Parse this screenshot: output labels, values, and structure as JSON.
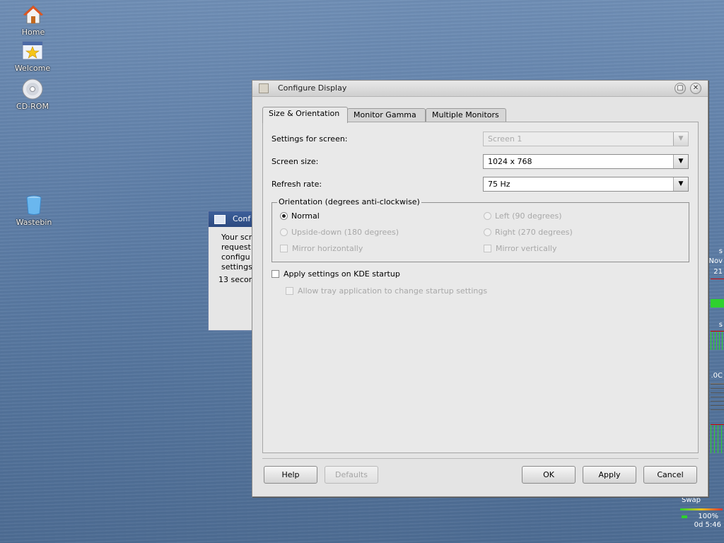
{
  "desktop": {
    "icons": [
      {
        "label": "Home",
        "icon": "home-icon"
      },
      {
        "label": "Welcome",
        "icon": "welcome-star-icon"
      },
      {
        "label": "CD-ROM",
        "icon": "cdrom-icon"
      },
      {
        "label": "Wastebin",
        "icon": "wastebin-icon"
      }
    ]
  },
  "bg_dialog": {
    "title": "Conf",
    "lines": [
      "Your scr",
      "request",
      "configu",
      "settings"
    ],
    "countdown": "13 secon"
  },
  "side_widgets": {
    "s1": "s",
    "nov": "Nov",
    "day": "21",
    "s2": "s",
    "temp": ".0C",
    "swap_label": "Swap",
    "swap_pct": "100%",
    "uptime": "0d  5:46"
  },
  "window": {
    "title": "Configure Display",
    "tabs": [
      "Size & Orientation",
      "Monitor Gamma",
      "Multiple Monitors"
    ],
    "settings_for_screen": {
      "label": "Settings for screen:",
      "value": "Screen 1"
    },
    "screen_size": {
      "label": "Screen size:",
      "value": "1024 x 768"
    },
    "refresh_rate": {
      "label": "Refresh rate:",
      "value": "75 Hz"
    },
    "orientation": {
      "legend": "Orientation (degrees anti-clockwise)",
      "normal": "Normal",
      "left": "Left (90 degrees)",
      "upside_down": "Upside-down (180 degrees)",
      "right": "Right (270 degrees)",
      "mirror_h": "Mirror horizontally",
      "mirror_v": "Mirror vertically"
    },
    "apply_on_startup": "Apply settings on KDE startup",
    "allow_tray": "Allow tray application to change startup settings",
    "buttons": {
      "help": "Help",
      "defaults": "Defaults",
      "ok": "OK",
      "apply": "Apply",
      "cancel": "Cancel"
    }
  },
  "colors": {
    "titlebar_bg": "#d9d9d9",
    "dialog_bg": "#e9e9e9",
    "bg_dialog_titlebar": "#2c4a80",
    "desktop": "#5f7fa8"
  }
}
